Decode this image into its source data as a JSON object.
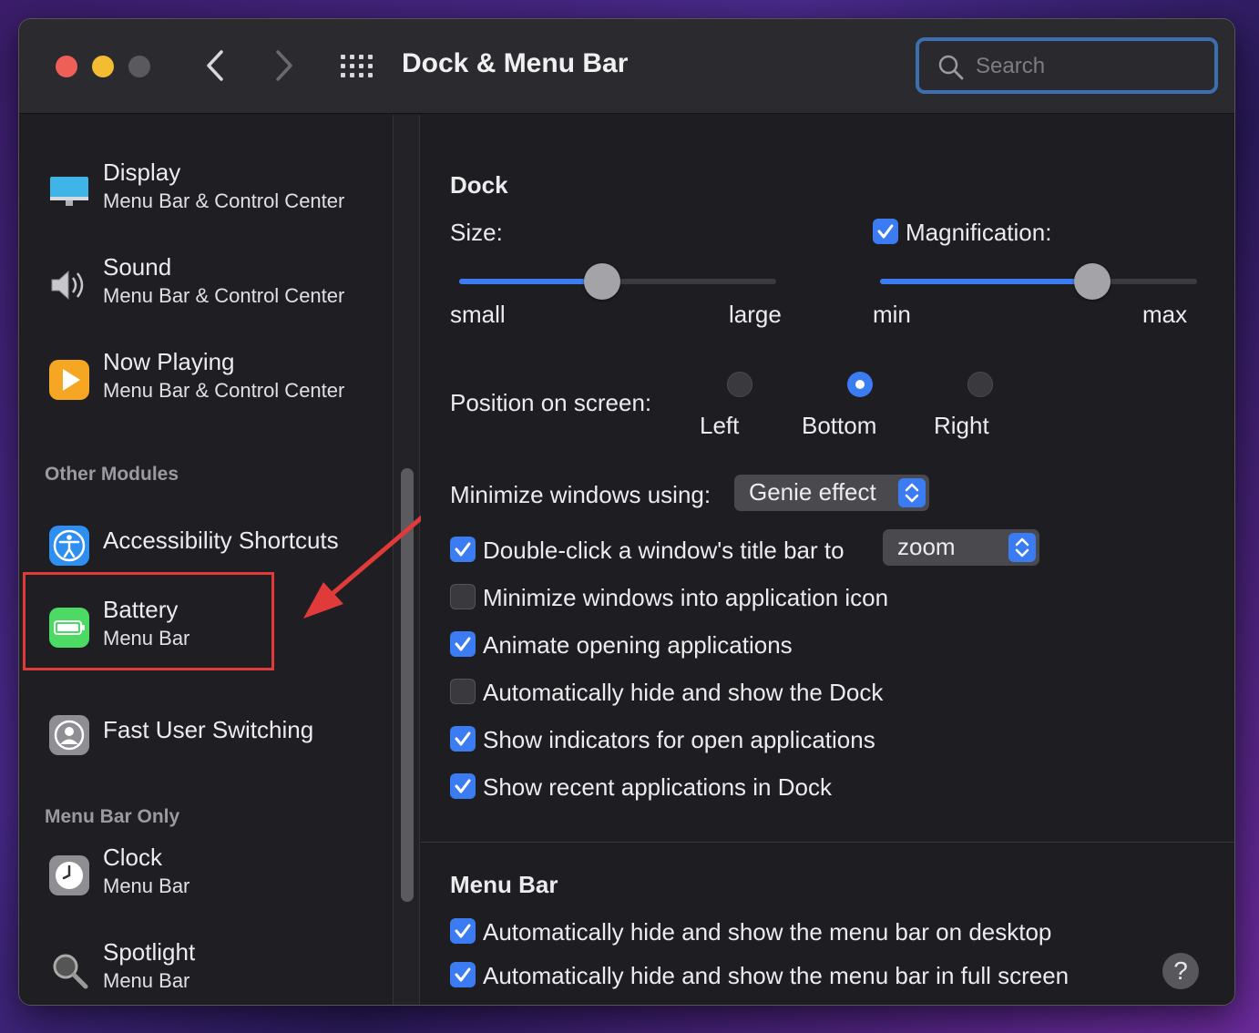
{
  "window": {
    "title": "Dock & Menu Bar"
  },
  "search": {
    "placeholder": "Search"
  },
  "sidebar": {
    "items_top": [
      {
        "title": "Display",
        "subtitle": "Menu Bar & Control Center",
        "icon": "display-icon"
      },
      {
        "title": "Sound",
        "subtitle": "Menu Bar & Control Center",
        "icon": "speaker-icon"
      },
      {
        "title": "Now Playing",
        "subtitle": "Menu Bar & Control Center",
        "icon": "play-icon"
      }
    ],
    "other_modules_header": "Other Modules",
    "other_modules": [
      {
        "title": "Accessibility Shortcuts",
        "icon": "accessibility-icon"
      },
      {
        "title": "Battery",
        "subtitle": "Menu Bar",
        "icon": "battery-icon"
      },
      {
        "title": "Fast User Switching",
        "icon": "user-icon"
      }
    ],
    "menu_bar_only_header": "Menu Bar Only",
    "menu_bar_only": [
      {
        "title": "Clock",
        "subtitle": "Menu Bar",
        "icon": "clock-icon"
      },
      {
        "title": "Spotlight",
        "subtitle": "Menu Bar",
        "icon": "spotlight-icon"
      }
    ]
  },
  "dock": {
    "section_title": "Dock",
    "size_label": "Size:",
    "size_min_label": "small",
    "size_max_label": "large",
    "size_value": 0.45,
    "magnification_label": "Magnification:",
    "magnification_checked": true,
    "mag_min_label": "min",
    "mag_max_label": "max",
    "magnification_value": 0.67,
    "position_label": "Position on screen:",
    "position_options": [
      "Left",
      "Bottom",
      "Right"
    ],
    "position_selected": "Bottom",
    "minimize_label": "Minimize windows using:",
    "minimize_value": "Genie effect",
    "double_click_label": "Double-click a window's title bar to",
    "double_click_checked": true,
    "double_click_value": "zoom",
    "options": [
      {
        "label": "Minimize windows into application icon",
        "checked": false
      },
      {
        "label": "Animate opening applications",
        "checked": true
      },
      {
        "label": "Automatically hide and show the Dock",
        "checked": false
      },
      {
        "label": "Show indicators for open applications",
        "checked": true
      },
      {
        "label": "Show recent applications in Dock",
        "checked": true
      }
    ]
  },
  "menubar": {
    "section_title": "Menu Bar",
    "options": [
      {
        "label": "Automatically hide and show the menu bar on desktop",
        "checked": true
      },
      {
        "label": "Automatically hide and show the menu bar in full screen",
        "checked": true
      }
    ]
  },
  "help": {
    "label": "?"
  },
  "colors": {
    "accent": "#3b7cf2",
    "highlight_box": "#e03a3a",
    "window_bg": "#1e1e22"
  }
}
